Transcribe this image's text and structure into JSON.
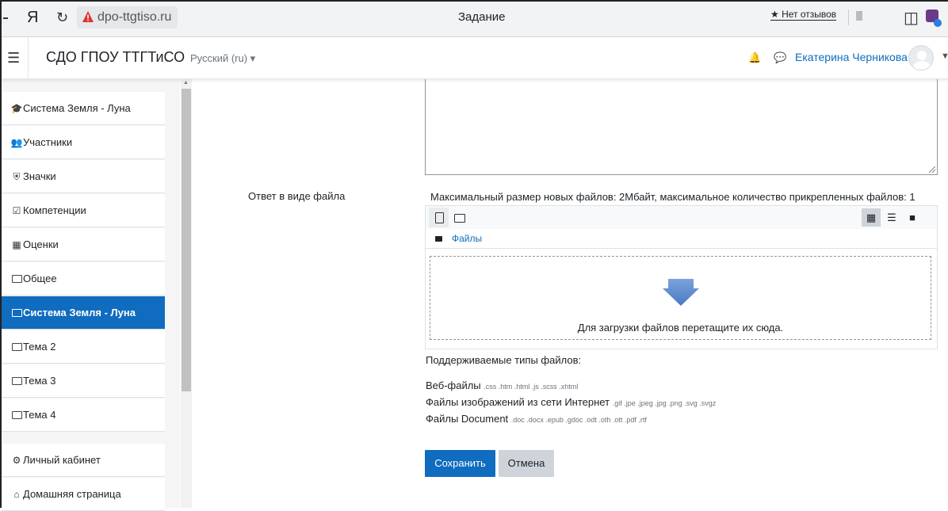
{
  "browser": {
    "logo": "Я",
    "reload_icon": "reload-icon",
    "url": "dpo-ttgtiso.ru",
    "tab_title": "Задание",
    "reviews": "★ Нет отзывов"
  },
  "navbar": {
    "site_name": "СДО ГПОУ ТТГТиСО",
    "language": "Русский (ru) ▾",
    "user_name": "Екатерина Черникова"
  },
  "sidebar": {
    "items": [
      {
        "label": "Система Земля - Луна",
        "icon": "graduation-cap-icon"
      },
      {
        "label": "Участники",
        "icon": "users-icon"
      },
      {
        "label": "Значки",
        "icon": "shield-icon"
      },
      {
        "label": "Компетенции",
        "icon": "checkbox-icon"
      },
      {
        "label": "Оценки",
        "icon": "table-icon"
      },
      {
        "label": "Общее",
        "icon": "folder-icon"
      },
      {
        "label": "Система Земля - Луна",
        "icon": "folder-icon",
        "active": true
      },
      {
        "label": "Тема 2",
        "icon": "folder-icon"
      },
      {
        "label": "Тема 3",
        "icon": "folder-icon"
      },
      {
        "label": "Тема 4",
        "icon": "folder-icon"
      },
      {
        "label": "Личный кабинет",
        "icon": "dashboard-icon"
      },
      {
        "label": "Домашняя страница",
        "icon": "home-icon"
      }
    ]
  },
  "form": {
    "file_label": "Ответ в виде файла",
    "max_size": "Максимальный размер новых файлов: 2Мбайт, максимальное количество прикрепленных файлов: 1",
    "path_label": "Файлы",
    "drop_text": "Для загрузки файлов перетащите их сюда.",
    "types_title": "Поддерживаемые типы файлов:",
    "types": [
      {
        "name": "Веб-файлы",
        "ext": ".css .htm .html .js .scss .xhtml"
      },
      {
        "name": "Файлы изображений из сети Интернет",
        "ext": ".gif .jpe .jpeg .jpg .png .svg .svgz"
      },
      {
        "name": "Файлы Document",
        "ext": ".doc .docx .epub .gdoc .odt .oth .ott .pdf .rtf"
      }
    ],
    "save_label": "Сохранить",
    "cancel_label": "Отмена"
  },
  "colors": {
    "primary": "#0f6cbf",
    "sidebar_bg": "#f5f5f5",
    "secondary_btn": "#ced4da"
  }
}
